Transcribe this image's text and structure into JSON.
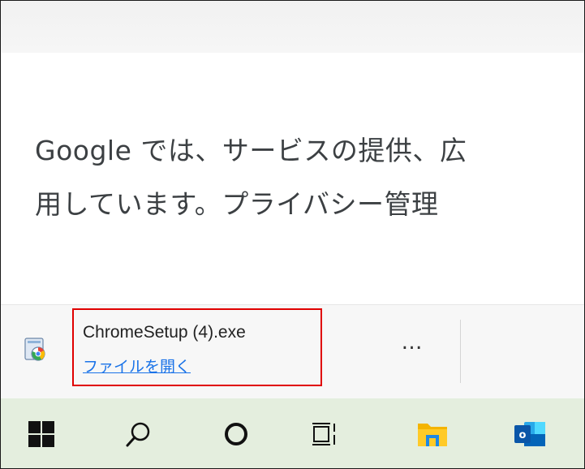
{
  "page": {
    "consent_line_1": "Google では、サービスの提供、広",
    "consent_line_2": "用しています。プライバシー管理"
  },
  "download_bar": {
    "file_name": "ChromeSetup (4).exe",
    "open_file_label": "ファイルを開く",
    "more_label": "…",
    "file_icon": "installer-icon"
  },
  "taskbar": {
    "icons": [
      "windows-start-icon",
      "search-icon",
      "cortana-icon",
      "task-view-icon",
      "file-explorer-icon",
      "outlook-icon"
    ]
  },
  "colors": {
    "link": "#1a73e8",
    "highlight": "#e00000",
    "taskbar": "#e4eede",
    "text": "#3c4043"
  }
}
